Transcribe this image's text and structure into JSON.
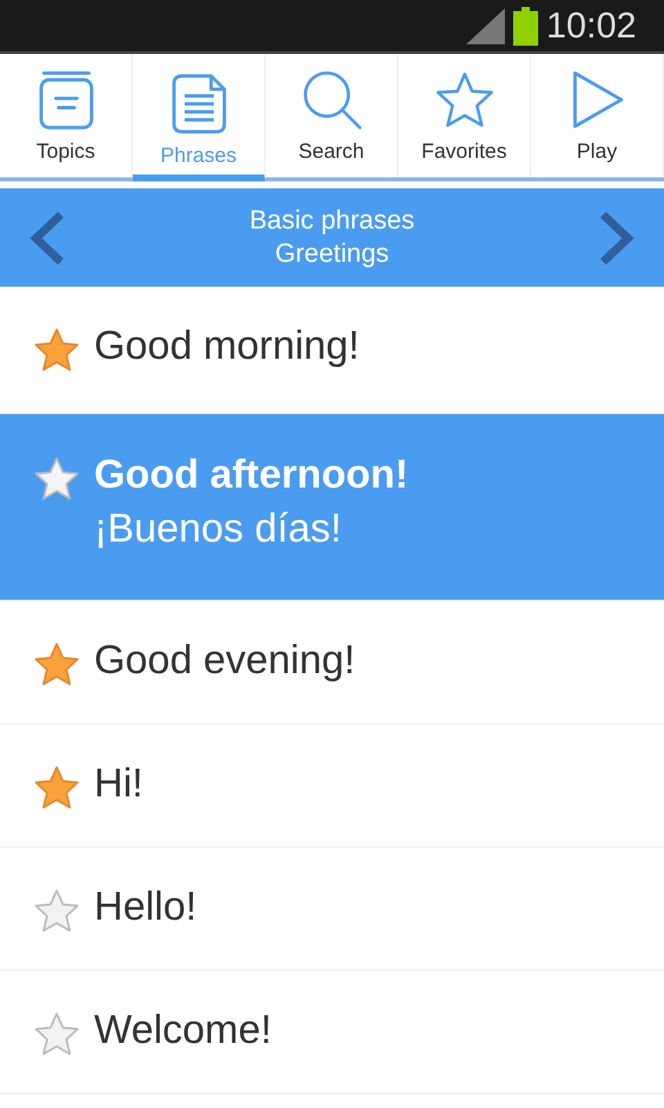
{
  "status_bar": {
    "time": "10:02"
  },
  "tabs": [
    {
      "kind": "topics",
      "label": "Topics",
      "selected": false
    },
    {
      "kind": "phrases",
      "label": "Phrases",
      "selected": true
    },
    {
      "kind": "search",
      "label": "Search",
      "selected": false
    },
    {
      "kind": "favorites",
      "label": "Favorites",
      "selected": false
    },
    {
      "kind": "play",
      "label": "Play",
      "selected": false
    }
  ],
  "header": {
    "title": "Basic phrases",
    "subtitle": "Greetings"
  },
  "phrases": [
    {
      "text": "Good morning!",
      "favorite": true,
      "selected": false
    },
    {
      "text": "Good afternoon!",
      "translation": "¡Buenos días!",
      "favorite": false,
      "selected": true
    },
    {
      "text": "Good evening!",
      "favorite": true,
      "selected": false
    },
    {
      "text": "Hi!",
      "favorite": true,
      "selected": false
    },
    {
      "text": "Hello!",
      "favorite": false,
      "selected": false
    },
    {
      "text": "Welcome!",
      "favorite": false,
      "selected": false
    }
  ]
}
